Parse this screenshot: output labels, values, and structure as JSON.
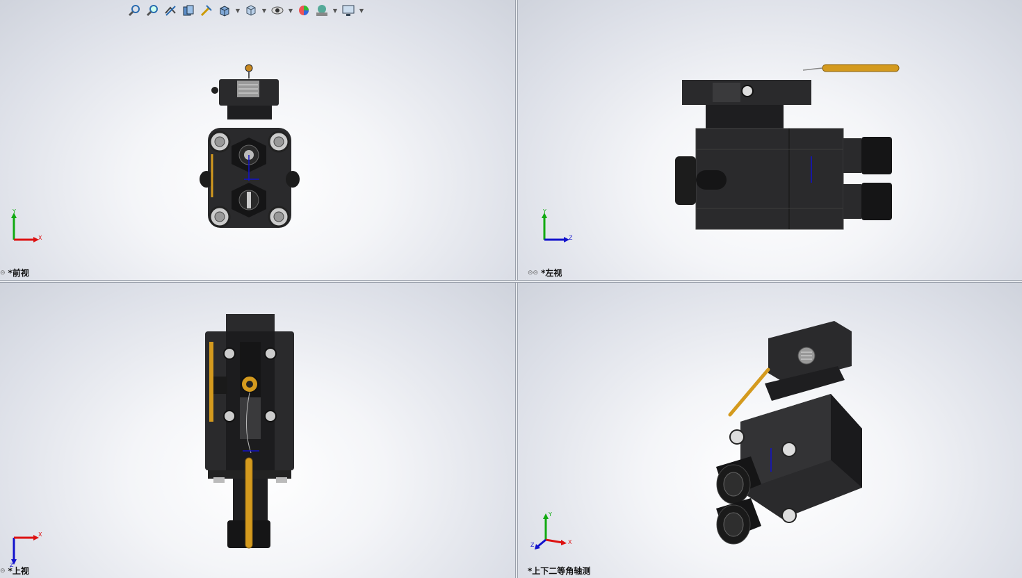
{
  "toolbar": {
    "items": [
      {
        "name": "zoom-to-fit-icon"
      },
      {
        "name": "zoom-to-area-icon"
      },
      {
        "name": "previous-view-icon"
      },
      {
        "name": "section-view-icon"
      },
      {
        "name": "dynamic-annotation-icon"
      },
      {
        "name": "view-orientation-icon"
      },
      {
        "name": "display-style-icon"
      },
      {
        "name": "hide-show-items-icon"
      },
      {
        "name": "edit-appearance-icon"
      },
      {
        "name": "apply-scene-icon"
      },
      {
        "name": "view-settings-icon"
      }
    ]
  },
  "viewports": {
    "front": {
      "label": "*前视",
      "x_axis": "X",
      "y_axis": "Y"
    },
    "left": {
      "label": "*左视",
      "x_axis": "Z",
      "y_axis": "Y"
    },
    "top": {
      "label": "*上视",
      "x_axis": "X",
      "y_axis": "Z"
    },
    "dimetric": {
      "label": "*上下二等角轴测",
      "x_axis": "X",
      "y_axis": "Y",
      "z_axis": "Z"
    }
  },
  "colors": {
    "body": "#2a2a2c",
    "body_dark": "#151516",
    "metal": "#d8d8d8",
    "probe": "#d49a1e",
    "axis_x": "#d11",
    "axis_y": "#1a1",
    "axis_z": "#11c"
  }
}
